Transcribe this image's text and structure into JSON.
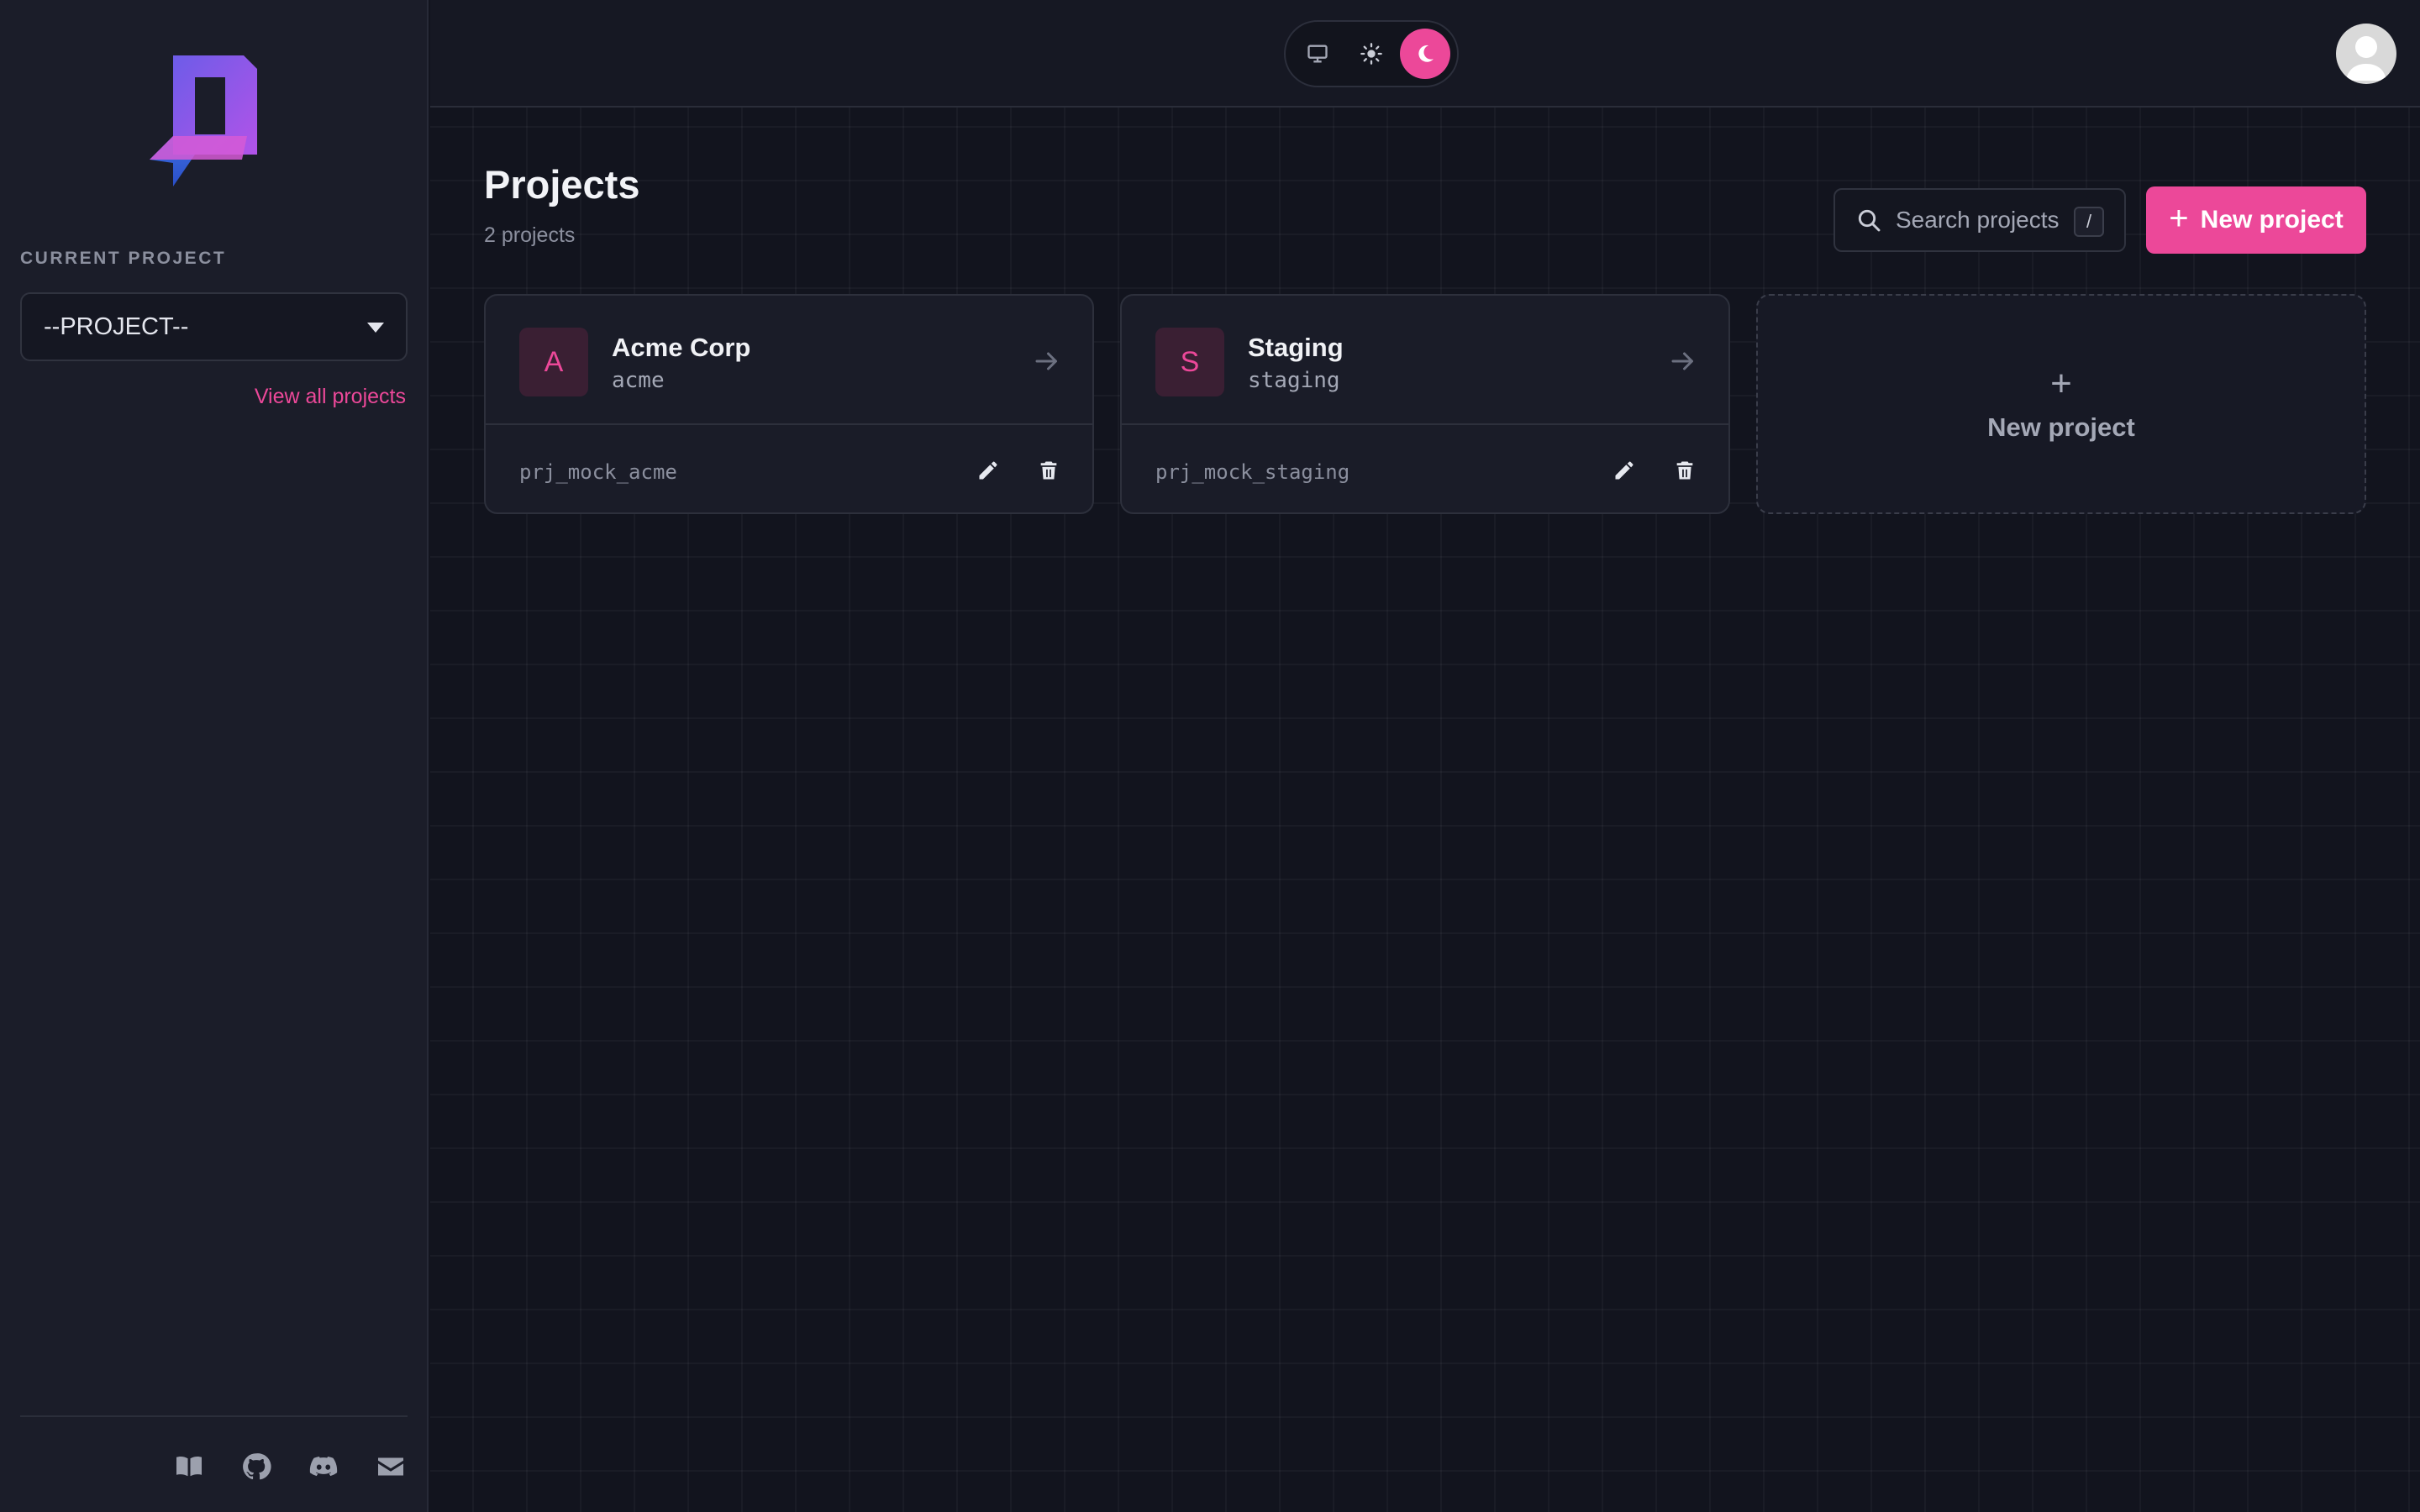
{
  "sidebar": {
    "current_project_label": "CURRENT PROJECT",
    "project_select_value": "--PROJECT--",
    "view_all_label": "View all projects",
    "footer_icons": [
      "docs-book-icon",
      "github-icon",
      "discord-icon",
      "mail-icon"
    ]
  },
  "topbar": {
    "theme_options": [
      "system",
      "light",
      "dark"
    ],
    "active_theme": "dark"
  },
  "page": {
    "title": "Projects",
    "count_text": "2 projects",
    "search_placeholder": "Search projects",
    "search_shortcut": "/",
    "new_project_label": "New project"
  },
  "projects": [
    {
      "initial": "A",
      "name": "Acme Corp",
      "slug": "acme",
      "id": "prj_mock_acme"
    },
    {
      "initial": "S",
      "name": "Staging",
      "slug": "staging",
      "id": "prj_mock_staging"
    }
  ],
  "new_project_card_label": "New project",
  "colors": {
    "accent": "#ec4899",
    "background": "#12141e",
    "sidebar": "#1b1d29"
  }
}
